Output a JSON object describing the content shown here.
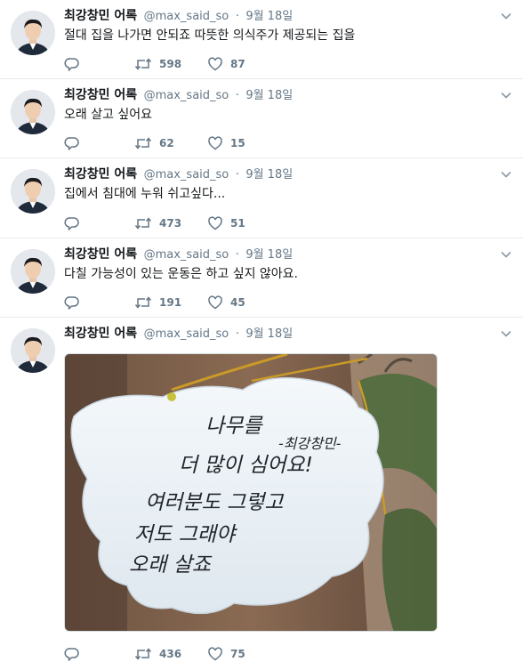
{
  "tweets": [
    {
      "name": "최강창민 어록",
      "handle": "@max_said_so",
      "separator": "·",
      "time": "9월 18일",
      "text": "절대 집을 나가면 안되죠 따뜻한 의식주가 제공되는 집을",
      "retweets": "598",
      "likes": "87"
    },
    {
      "name": "최강창민 어록",
      "handle": "@max_said_so",
      "separator": "·",
      "time": "9월 18일",
      "text": "오래 살고 싶어요",
      "retweets": "62",
      "likes": "15"
    },
    {
      "name": "최강창민 어록",
      "handle": "@max_said_so",
      "separator": "·",
      "time": "9월 18일",
      "text": "집에서 침대에 누워 쉬고싶다...",
      "retweets": "473",
      "likes": "51"
    },
    {
      "name": "최강창민 어록",
      "handle": "@max_said_so",
      "separator": "·",
      "time": "9월 18일",
      "text": "다칠 가능성이 있는 운동은 하고 싶지 않아요.",
      "retweets": "191",
      "likes": "45"
    },
    {
      "name": "최강창민 어록",
      "handle": "@max_said_so",
      "separator": "·",
      "time": "9월 18일",
      "text": "",
      "media_text": {
        "line1": "나무를",
        "signature": "-최강창민-",
        "line2": "더 많이 심어요!",
        "line3": "여러분도 그렇고",
        "line4": "저도 그래야",
        "line5": "오래 살죠"
      },
      "retweets": "436",
      "likes": "75"
    }
  ],
  "icons": {
    "reply": "reply-icon",
    "retweet": "retweet-icon",
    "like": "heart-icon",
    "caret": "chevron-down-icon"
  },
  "colors": {
    "text": "#14171a",
    "secondary": "#657786",
    "divider": "#e6ecf0"
  }
}
